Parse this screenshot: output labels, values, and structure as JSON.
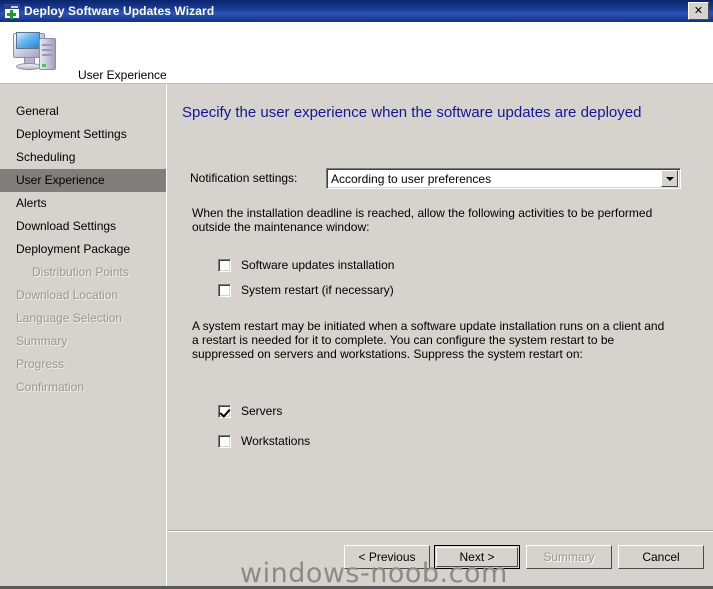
{
  "window": {
    "title": "Deploy Software Updates Wizard",
    "titlebar_icon": "wizard-window-plus-icon",
    "close_label": "✕"
  },
  "header": {
    "icon": "computer-monitor-icon",
    "title": "User Experience"
  },
  "sidebar": {
    "items": [
      {
        "label": "General",
        "state": "enabled",
        "indent": false
      },
      {
        "label": "Deployment Settings",
        "state": "enabled",
        "indent": false
      },
      {
        "label": "Scheduling",
        "state": "enabled",
        "indent": false
      },
      {
        "label": "User Experience",
        "state": "selected",
        "indent": false
      },
      {
        "label": "Alerts",
        "state": "enabled",
        "indent": false
      },
      {
        "label": "Download Settings",
        "state": "enabled",
        "indent": false
      },
      {
        "label": "Deployment Package",
        "state": "enabled",
        "indent": false
      },
      {
        "label": "Distribution Points",
        "state": "disabled",
        "indent": true
      },
      {
        "label": "Download Location",
        "state": "disabled",
        "indent": false
      },
      {
        "label": "Language Selection",
        "state": "disabled",
        "indent": false
      },
      {
        "label": "Summary",
        "state": "disabled",
        "indent": false
      },
      {
        "label": "Progress",
        "state": "disabled",
        "indent": false
      },
      {
        "label": "Confirmation",
        "state": "disabled",
        "indent": false
      }
    ]
  },
  "content": {
    "heading": "Specify the user experience when the software updates are deployed",
    "notification": {
      "label": "Notification settings:",
      "value": "According to user preferences",
      "arrow_icon": "chevron-down-icon"
    },
    "deadline_paragraph": "When the installation deadline is reached, allow the following activities to be performed outside the maintenance window:",
    "deadline_checkboxes": [
      {
        "label": "Software updates installation",
        "checked": false
      },
      {
        "label": "System restart (if necessary)",
        "checked": false
      }
    ],
    "restart_paragraph": "A system restart may be initiated when a software update installation runs on a client and a restart is needed for it to complete. You can configure the system restart to be suppressed on servers and workstations. Suppress the system restart on:",
    "suppress_checkboxes": [
      {
        "label": "Servers",
        "checked": true
      },
      {
        "label": "Workstations",
        "checked": false
      }
    ]
  },
  "footer": {
    "buttons": [
      {
        "label": "< Previous",
        "state": "enabled"
      },
      {
        "label": "Next >",
        "state": "default"
      },
      {
        "label": "Summary",
        "state": "disabled"
      },
      {
        "label": "Cancel",
        "state": "enabled"
      }
    ]
  },
  "watermark": {
    "text": "windows-noob.com"
  },
  "colors": {
    "titlebar": "#0a246a",
    "window_face": "#d6d3ce",
    "heading_blue": "#12169c",
    "selection_grey": "#817f7c",
    "disabled_text": "#9b968f",
    "watermark_grey": "#8d8a85"
  }
}
